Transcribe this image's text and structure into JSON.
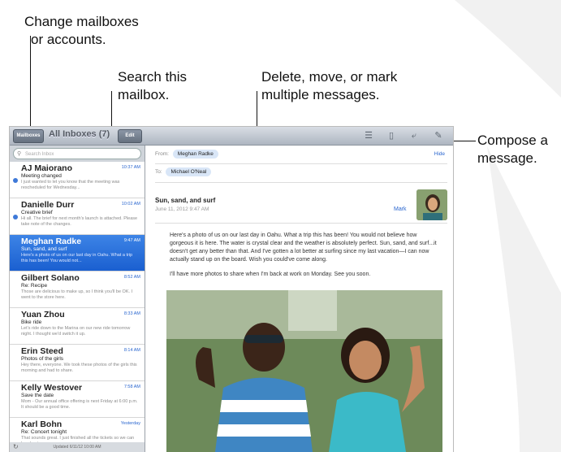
{
  "callouts": {
    "change_mailboxes": [
      "Change mailboxes",
      "or accounts."
    ],
    "search": [
      "Search this",
      "mailbox."
    ],
    "delete_move": [
      "Delete, move, or mark",
      "multiple messages."
    ],
    "compose": [
      "Compose a",
      "message."
    ]
  },
  "toolbar": {
    "mailboxes_label": "Mailboxes",
    "title": "All Inboxes (7)",
    "edit_label": "Edit",
    "icons": [
      "move-to-folder-icon",
      "trash-icon",
      "reply-icon",
      "compose-icon"
    ]
  },
  "search": {
    "placeholder": "Search Inbox"
  },
  "messages": [
    {
      "from": "AJ Maiorano",
      "time": "10:37 AM",
      "subject": "Meeting changed",
      "preview": "I just wanted to let you know that the meeting was rescheduled for Wednesday...",
      "unread": true,
      "selected": false
    },
    {
      "from": "Danielle Durr",
      "time": "10:02 AM",
      "subject": "Creative brief",
      "preview": "Hi all. The brief for next month's launch is attached. Please take note of the changes.",
      "unread": true,
      "selected": false
    },
    {
      "from": "Meghan Radke",
      "time": "9:47 AM",
      "subject": "Sun, sand, and surf",
      "preview": "Here's a photo of us on our last day in Oahu. What a trip this has been! You would not...",
      "unread": false,
      "selected": true
    },
    {
      "from": "Gilbert Solano",
      "time": "8:52 AM",
      "subject": "Re: Recipe",
      "preview": "Those are delicious to make up, so I think you'll be OK. I went to the store here.",
      "unread": false,
      "selected": false
    },
    {
      "from": "Yuan Zhou",
      "time": "8:33 AM",
      "subject": "Bike ride",
      "preview": "Let's ride down to the Marina on our new ride tomorrow night. I thought we'd switch it up.",
      "unread": false,
      "selected": false
    },
    {
      "from": "Erin Steed",
      "time": "8:14 AM",
      "subject": "Photos of the girls",
      "preview": "Hey there, everyone. We took these photos of the girls this morning and had to share.",
      "unread": false,
      "selected": false
    },
    {
      "from": "Kelly Westover",
      "time": "7:58 AM",
      "subject": "Save the date",
      "preview": "Mom - Our annual office offering is next Friday at 6:00 p.m. It should be a good time.",
      "unread": false,
      "selected": false
    },
    {
      "from": "Karl Bohn",
      "time": "Yesterday",
      "subject": "Re: Concert tonight",
      "preview": "That sounds great. I just finished all the tickets so we can head out.",
      "unread": false,
      "selected": false
    }
  ],
  "footer": {
    "updated": "Updated 6/11/12 10:00 AM"
  },
  "message": {
    "from_label": "From:",
    "from_name": "Meghan Radke",
    "hide_label": "Hide",
    "to_label": "To:",
    "to_name": "Michael O'Neal",
    "subject": "Sun, sand, and surf",
    "date": "June 11, 2012 9:47 AM",
    "mark_label": "Mark",
    "body": [
      "Here's a photo of us on our last day in Oahu. What a trip this has been! You would not believe how gorgeous it is here. The water is crystal clear and the weather is absolutely perfect. Sun, sand, and surf...it doesn't get any better than that. And I've gotten a lot better at surfing since my last vacation—I can now actually stand up on the board. Wish you could've come along.",
      "I'll have more photos to share when I'm back at work on Monday. See you soon."
    ]
  },
  "colors": {
    "accent": "#2a66cf",
    "selection": "#1a5fd0",
    "unread_dot": "#3e79d8"
  }
}
